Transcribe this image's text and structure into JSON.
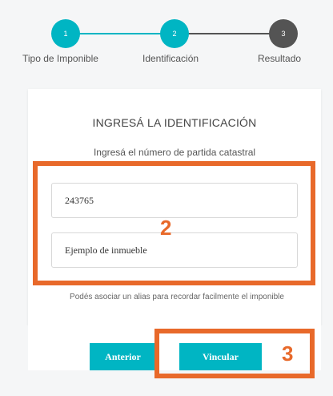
{
  "stepper": {
    "steps": [
      {
        "number": "1",
        "label": "Tipo de Imponible",
        "color": "#00b5c3"
      },
      {
        "number": "2",
        "label": "Identificación",
        "color": "#00b5c3"
      },
      {
        "number": "3",
        "label": "Resultado",
        "color": "#545454"
      }
    ],
    "line_colors": {
      "done": "#00b5c3",
      "pending": "#545454"
    }
  },
  "form": {
    "title": "INGRESÁ LA IDENTIFICACIÓN",
    "subtitle": "Ingresá el número de partida catastral",
    "partida_value": "243765",
    "alias_value": "Ejemplo de inmueble",
    "hint": "Podés asociar un alias para recordar facilmente el imponible"
  },
  "buttons": {
    "prev_label": "Anterior",
    "link_label": "Vincular"
  },
  "annotations": {
    "box_2_number": "2",
    "box_3_number": "3",
    "color": "#e8692a"
  },
  "colors": {
    "accent": "#00b5c3",
    "background": "#f5f6f7"
  }
}
